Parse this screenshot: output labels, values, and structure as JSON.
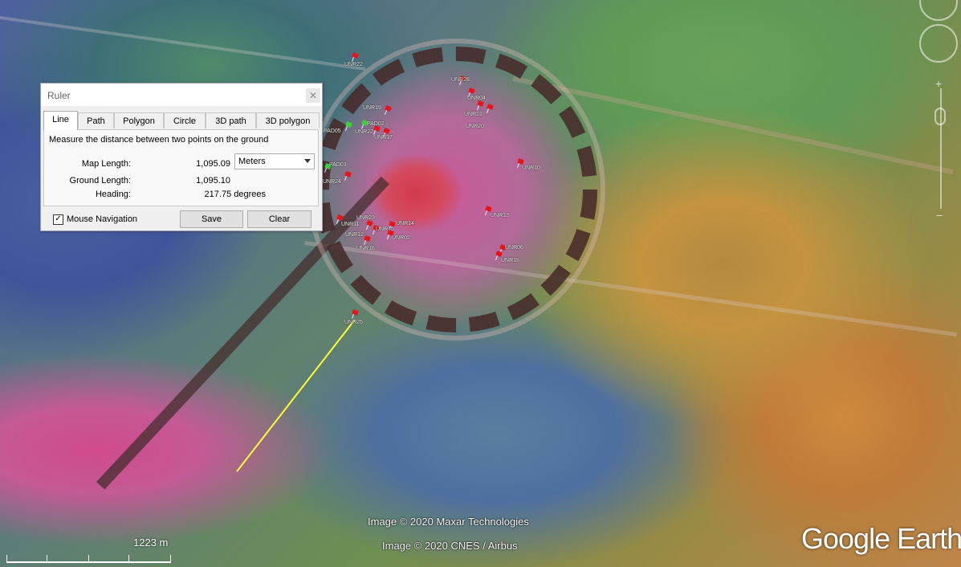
{
  "ruler": {
    "title": "Ruler",
    "close_icon": "close-icon",
    "tabs": [
      "Line",
      "Path",
      "Polygon",
      "Circle",
      "3D path",
      "3D polygon"
    ],
    "active_tab": "Line",
    "description": "Measure the distance between two points on the ground",
    "map_length_label": "Map Length:",
    "map_length_value": "1,095.09",
    "unit": "Meters",
    "ground_length_label": "Ground Length:",
    "ground_length_value": "1,095.10",
    "heading_label": "Heading:",
    "heading_value": "217.75 degrees",
    "mouse_navigation_label": "Mouse Navigation",
    "mouse_navigation_checked": true,
    "save_label": "Save",
    "clear_label": "Clear"
  },
  "map": {
    "credit_1": "Image © 2020 Maxar Technologies",
    "credit_2": "Image © 2020 CNES / Airbus",
    "brand": "Google Earth",
    "scale_label": "1223 m",
    "ruler_line_color": "#ffff33",
    "pin_labels": [
      "UNR22",
      "UNR25",
      "UNR28",
      "UNR04",
      "UNR21",
      "UNR20",
      "UNR10",
      "UNR13",
      "UNR18",
      "UNR06",
      "UNR19",
      "UNR22",
      "UNR14",
      "UNR23",
      "UNR02",
      "UNR16",
      "UNR17",
      "UNR15",
      "PAD02",
      "PAD03",
      "PAD05",
      "UNR24",
      "UNR11",
      "UNR12"
    ]
  }
}
